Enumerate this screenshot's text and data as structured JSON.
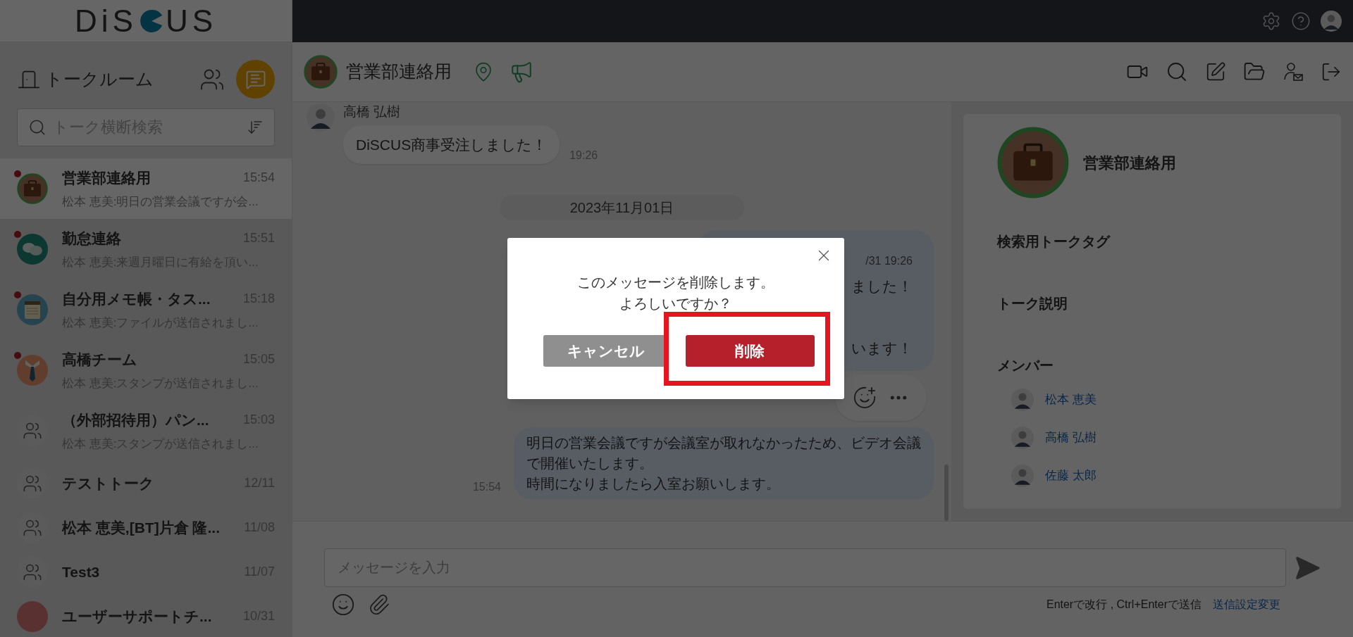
{
  "logo": {
    "left": "DiS",
    "right": "US"
  },
  "sidebar": {
    "title": "トークルーム",
    "search": {
      "placeholder": "トーク横断検索"
    },
    "items": [
      {
        "name": "営業部連絡用",
        "time": "15:54",
        "preview": "松本 恵美:明日の営業会議ですが会...",
        "kind": "briefcase",
        "unread": true,
        "selected": true
      },
      {
        "name": "勤怠連絡",
        "time": "15:51",
        "preview": "松本 恵美:来週月曜日に有給を頂い...",
        "kind": "chat",
        "unread": true,
        "selected": false
      },
      {
        "name": "自分用メモ帳・タス...",
        "time": "15:18",
        "preview": "松本 恵美:ファイルが送信されまし...",
        "kind": "notepad",
        "unread": true,
        "selected": false
      },
      {
        "name": "高橋チーム",
        "time": "15:05",
        "preview": "松本 恵美:スタンプが送信されまし...",
        "kind": "tie",
        "unread": true,
        "selected": false
      },
      {
        "name": "（外部招待用）パン...",
        "time": "15:03",
        "preview": "松本 恵美:スタンプが送信されまし...",
        "kind": "group",
        "unread": false,
        "selected": false
      },
      {
        "name": "テストトーク",
        "time": "12/11",
        "kind": "group",
        "unread": false,
        "selected": false
      },
      {
        "name": "松本 恵美,[BT]片倉 隆...",
        "time": "11/08",
        "kind": "group",
        "unread": false,
        "selected": false
      },
      {
        "name": "Test3",
        "time": "11/07",
        "kind": "group",
        "unread": false,
        "selected": false
      },
      {
        "name": "ユーザーサポートチ...",
        "time": "10/31",
        "kind": "plain",
        "unread": false,
        "selected": false
      }
    ]
  },
  "chat": {
    "title": "営業部連絡用",
    "messages": [
      {
        "kind": "incoming",
        "sender": "高橋 弘樹",
        "text": "DiSCUS商事受注しました！",
        "time": "19:26"
      },
      {
        "kind": "date",
        "text": "2023年11月01日"
      },
      {
        "kind": "partial",
        "lines": [
          "/31 19:26",
          "ました！",
          "います！"
        ]
      },
      {
        "kind": "outgoing",
        "lines": [
          "明日の営業会議ですが会議室が取れなかったため、ビデオ会議",
          "で開催いたします。",
          "時間になりましたら入室お願いします。"
        ],
        "time": "15:54"
      }
    ],
    "input": {
      "placeholder": "メッセージを入力"
    },
    "hint": "Enterで改行 , Ctrl+Enterで送信",
    "settings_link": "送信設定変更"
  },
  "info_panel": {
    "title": "営業部連絡用",
    "tags_heading": "検索用トークタグ",
    "description_heading": "トーク説明",
    "members_heading": "メンバー",
    "members": [
      "松本 恵美",
      "高橋 弘樹",
      "佐藤 太郎"
    ]
  },
  "dialog": {
    "message": [
      "このメッセージを削除します。",
      "よろしいですか？"
    ],
    "cancel": "キャンセル",
    "confirm": "削除",
    "confirm_highlighted": true
  }
}
